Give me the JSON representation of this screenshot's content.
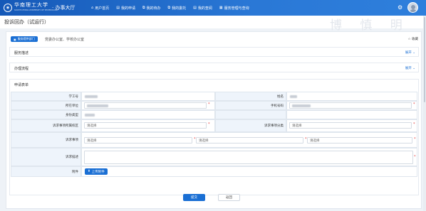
{
  "header": {
    "logo_text": "华南理工大学",
    "logo_sub": "SOUTH CHINA UNIVERSITY OF TECHNOLOGY",
    "app_title": "· 办事大厅",
    "nav": [
      {
        "label": "用户首页",
        "icon": "home-icon",
        "glyph": "⌂"
      },
      {
        "label": "我的申请",
        "icon": "apply-icon",
        "glyph": "▤"
      },
      {
        "label": "我的待办",
        "icon": "todo-icon",
        "glyph": "⧉"
      },
      {
        "label": "我的委托",
        "icon": "delegate-icon",
        "glyph": "⧉"
      },
      {
        "label": "我的查阅",
        "icon": "review-icon",
        "glyph": "▤"
      },
      {
        "label": "服务管理与查询",
        "icon": "manage-icon",
        "glyph": "▦"
      }
    ]
  },
  "page": {
    "title": "投诉回办（试运行）",
    "watermark": "博 慎 明 笃"
  },
  "service": {
    "dept_button": "服务提供部门",
    "dept_list": "党委办公室、学校办公室",
    "favorite": "收藏",
    "favorite_icon": "☆"
  },
  "sections": {
    "description": {
      "title": "服务描述",
      "expand": "展开 ⌄"
    },
    "process": {
      "title": "办理流程",
      "expand": "展开 ⌄"
    }
  },
  "form": {
    "title": "申请表单",
    "student_id_label": "学工号",
    "name_label": "姓名",
    "unit_label": "所在单位",
    "phone_label": "手机号码",
    "identity_label": "身份类型",
    "campus_label": "诉求事项所属校区",
    "campus_placeholder": "请选择",
    "category_label": "诉求事项分类",
    "category_placeholder": "请选择",
    "matter_label": "诉求事项",
    "matter_placeholder_1": "请选择",
    "matter_placeholder_2": "请选择",
    "matter_placeholder_3": "请选择",
    "desc_label": "诉求描述",
    "attachment_label": "附件",
    "upload_button": "上传附件",
    "required_mark": "*"
  },
  "actions": {
    "submit": "提交",
    "back": "返回"
  },
  "colors": {
    "primary": "#1a6fd4",
    "required": "#e23c3c",
    "label_bg": "#eef4fb"
  }
}
